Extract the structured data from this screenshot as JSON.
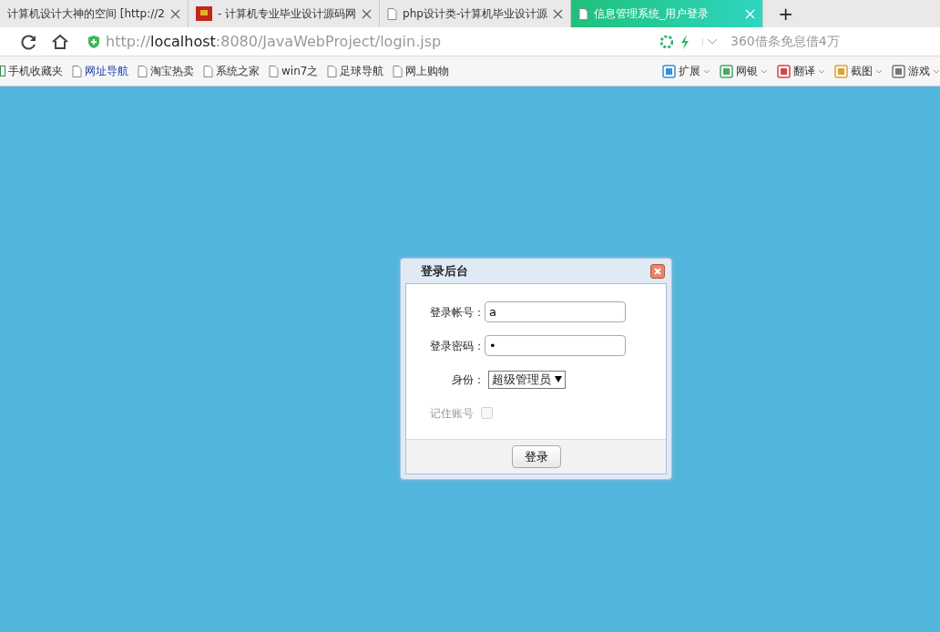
{
  "browser": {
    "tabs": [
      {
        "title": "计算机设计大神的空间 [http://2",
        "kind": "plain",
        "selected": false
      },
      {
        "title": "- 计算机专业毕业设计源码网",
        "kind": "site",
        "selected": false
      },
      {
        "title": "php设计类-计算机毕业设计源",
        "kind": "page",
        "selected": false
      },
      {
        "title": "信息管理系统_用户登录",
        "kind": "page",
        "selected": true
      }
    ],
    "new_tab": "+",
    "address": "http://**localhost**:8080/JavaWebProject/login.jsp",
    "ad_text": "360借条免息借4万",
    "bookmarks": [
      {
        "label": "手机收藏夹",
        "kind": "phone",
        "highlight": false
      },
      {
        "label": "网址导航",
        "kind": "page",
        "highlight": true
      },
      {
        "label": "淘宝热卖",
        "kind": "page",
        "highlight": false
      },
      {
        "label": "系统之家",
        "kind": "page",
        "highlight": false
      },
      {
        "label": "win7之",
        "kind": "page",
        "highlight": false
      },
      {
        "label": "足球导航",
        "kind": "page",
        "highlight": false
      },
      {
        "label": "网上购物",
        "kind": "page",
        "highlight": false
      }
    ],
    "tools": [
      {
        "label": "扩展",
        "kind": "extend"
      },
      {
        "label": "网银",
        "kind": "bank"
      },
      {
        "label": "翻译",
        "kind": "translate"
      },
      {
        "label": "截图",
        "kind": "screenshot"
      },
      {
        "label": "游戏",
        "kind": "game"
      }
    ]
  },
  "dialog": {
    "title": "登录后台",
    "fields": [
      {
        "label": "登录帐号：",
        "kind": "text",
        "value": "a"
      },
      {
        "label": "登录密码：",
        "kind": "text",
        "value": "•"
      },
      {
        "label": "身份：",
        "kind": "select",
        "value": "超级管理员"
      }
    ],
    "remember": {
      "label": "记住账号",
      "checked": false,
      "disabled": true
    },
    "submit": "登录"
  }
}
